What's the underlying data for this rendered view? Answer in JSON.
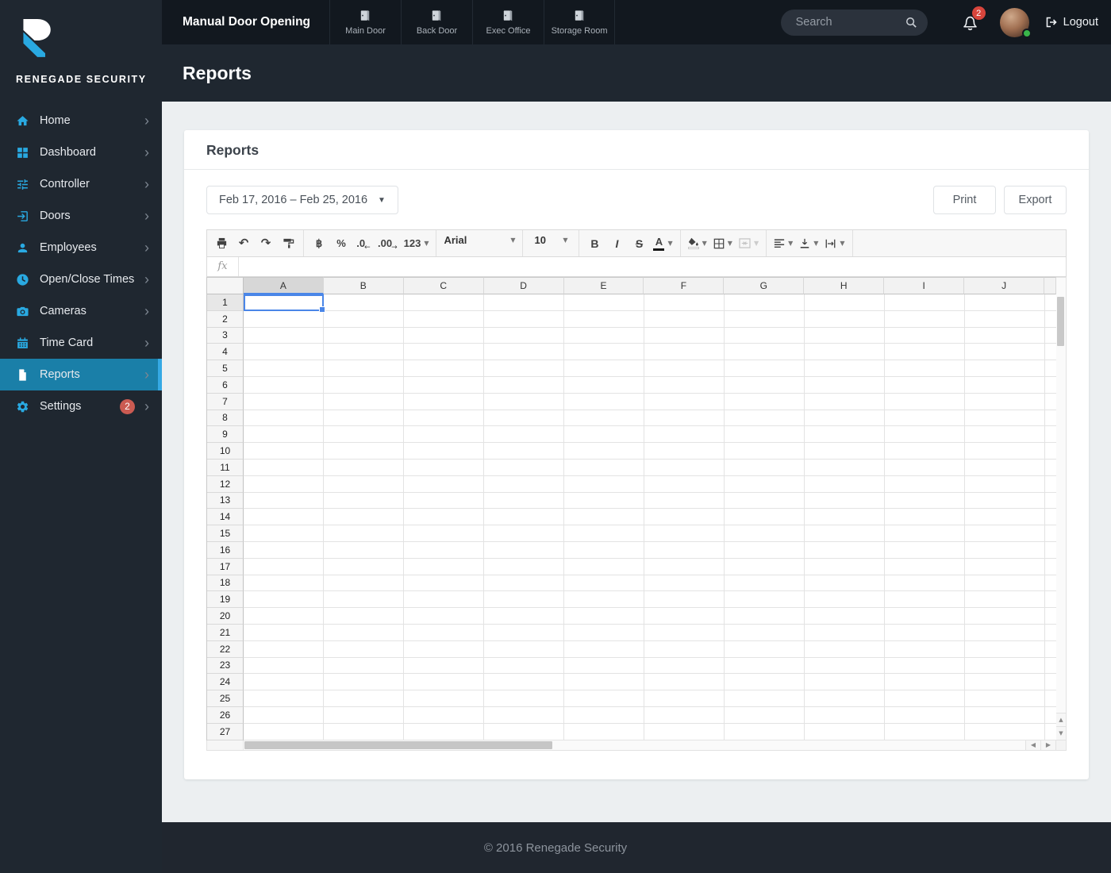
{
  "brand": {
    "name": "RENEGADE SECURITY"
  },
  "topbar": {
    "title": "Manual Door Opening",
    "doors": [
      {
        "label": "Main Door",
        "icon": "door-icon"
      },
      {
        "label": "Back Door",
        "icon": "door-icon"
      },
      {
        "label": "Exec Office",
        "icon": "door-icon"
      },
      {
        "label": "Storage Room",
        "icon": "door-icon"
      }
    ],
    "search": {
      "placeholder": "Search",
      "icon": "search-icon"
    },
    "notifications": {
      "icon": "bell-icon",
      "count": "2"
    },
    "user": {
      "status": "online"
    },
    "logout_label": "Logout"
  },
  "page": {
    "subheader": "Reports"
  },
  "sidebar": {
    "items": [
      {
        "label": "Home",
        "icon": "home-icon"
      },
      {
        "label": "Dashboard",
        "icon": "dashboard-icon"
      },
      {
        "label": "Controller",
        "icon": "controller-icon"
      },
      {
        "label": "Doors",
        "icon": "doors-icon"
      },
      {
        "label": "Employees",
        "icon": "employees-icon"
      },
      {
        "label": "Open/Close Times",
        "icon": "clock-icon"
      },
      {
        "label": "Cameras",
        "icon": "camera-icon"
      },
      {
        "label": "Time Card",
        "icon": "calendar-icon"
      },
      {
        "label": "Reports",
        "icon": "report-icon",
        "active": true
      },
      {
        "label": "Settings",
        "icon": "gear-icon",
        "badge": "2"
      }
    ]
  },
  "card": {
    "title": "Reports",
    "date_range": "Feb 17, 2016  –  Feb 25, 2016",
    "print_label": "Print",
    "export_label": "Export"
  },
  "sheet": {
    "toolbar": {
      "currency": "฿",
      "percent": "%",
      "decrease_decimal": ".0",
      "increase_decimal": ".00",
      "more_formats": "123",
      "font": "Arial",
      "font_size": "10",
      "bold": "B",
      "italic": "I",
      "strikethrough": "S",
      "text_color": "A"
    },
    "formula_label": "fx",
    "columns": [
      "A",
      "B",
      "C",
      "D",
      "E",
      "F",
      "G",
      "H",
      "I",
      "J"
    ],
    "row_count": 27,
    "selected": {
      "column": "A",
      "row": 1,
      "cell": "A1"
    }
  },
  "footer": {
    "copyright": "© 2016 Renegade Security"
  },
  "colors": {
    "accent_blue": "#29a9e1",
    "active_item_bg": "#1a7fa8",
    "badge_red": "#cb5b52",
    "notification_red": "#d8453c",
    "selection_blue": "#4a86e8",
    "online_green": "#39b54a"
  }
}
